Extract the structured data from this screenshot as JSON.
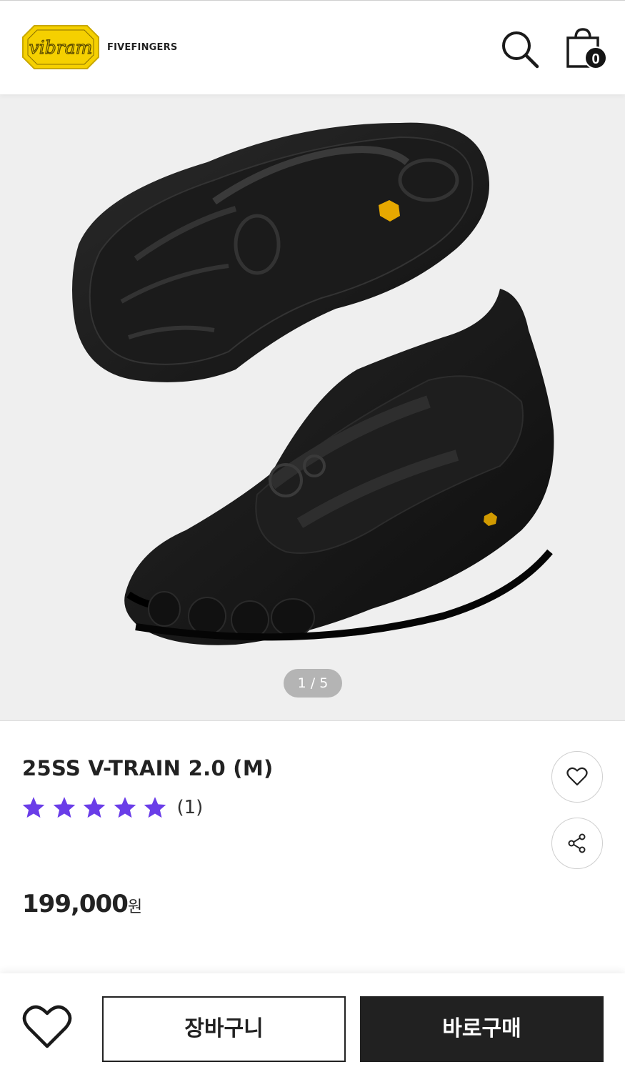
{
  "header": {
    "logo_wordmark": "vibram",
    "logo_text": "FIVEFINGERS",
    "cart_count": "0"
  },
  "gallery": {
    "pager": "1 / 5"
  },
  "product": {
    "title": "25SS V-TRAIN 2.0 (M)",
    "rating_stars": 5,
    "review_count": "(1)",
    "price": "199,000",
    "price_unit": "원"
  },
  "actions": {
    "cart_label": "장바구니",
    "buy_label": "바로구매"
  },
  "colors": {
    "star": "#6a3de8",
    "logo_yellow": "#f5d000",
    "dark_button": "#212121"
  },
  "icons": [
    "search-icon",
    "shopping-bag-icon",
    "heart-icon",
    "share-icon",
    "star-icon"
  ]
}
